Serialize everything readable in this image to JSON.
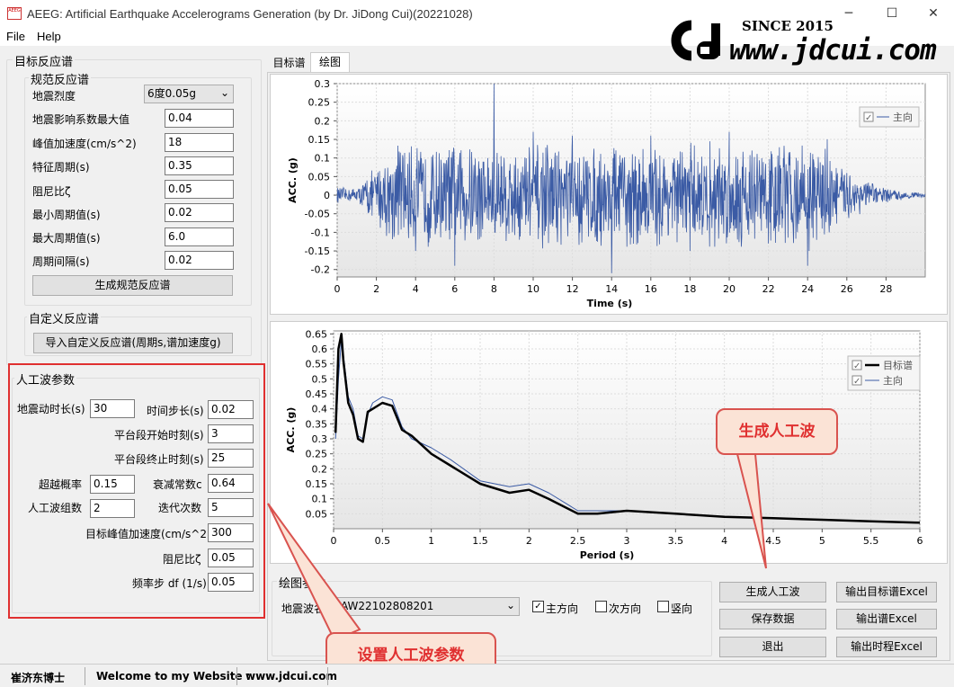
{
  "window": {
    "title": "AEEG: Artificial Earthquake Accelerograms Generation (by Dr. JiDong Cui)(20221028)",
    "icon_text": "AEEG"
  },
  "menu": {
    "file": "File",
    "help": "Help"
  },
  "logo": {
    "since": "SINCE 2015",
    "site": "www.jdcui.com"
  },
  "target": {
    "group": "目标反应谱",
    "code": {
      "group": "规范反应谱",
      "fields": [
        {
          "label": "地震烈度",
          "value": "6度0.05g"
        },
        {
          "label": "地震影响系数最大值",
          "value": "0.04"
        },
        {
          "label": "峰值加速度(cm/s^2)",
          "value": "18"
        },
        {
          "label": "特征周期(s)",
          "value": "0.35"
        },
        {
          "label": "阻尼比ζ",
          "value": "0.05"
        },
        {
          "label": "最小周期值(s)",
          "value": "0.02"
        },
        {
          "label": "最大周期值(s)",
          "value": "6.0"
        },
        {
          "label": "周期间隔(s)",
          "value": "0.02"
        }
      ],
      "button": "生成规范反应谱"
    },
    "custom": {
      "group": "自定义反应谱",
      "button": "导入自定义反应谱(周期s,谱加速度g)"
    }
  },
  "params": {
    "group": "人工波参数",
    "duration_label": "地震动时长(s)",
    "duration": "30",
    "step_label": "时间步长(s)",
    "step": "0.02",
    "plat_start_label": "平台段开始时刻(s)",
    "plat_start": "3",
    "plat_end_label": "平台段终止时刻(s)",
    "plat_end": "25",
    "exceed_label": "超越概率",
    "exceed": "0.15",
    "decay_label": "衰减常数c",
    "decay": "0.64",
    "groups_label": "人工波组数",
    "groups": "2",
    "iter_label": "迭代次数",
    "iter": "5",
    "pga_label": "目标峰值加速度(cm/s^2)",
    "pga": "300",
    "damp_label": "阻尼比ζ",
    "damp": "0.05",
    "df_label": "频率步 df (1/s)",
    "df": "0.05"
  },
  "tabs": [
    "目标谱",
    "绘图"
  ],
  "plot1": {
    "ylabel": "ACC. (g)",
    "xlabel": "Time (s)",
    "legend": "主向",
    "yticks": [
      "0.3",
      "0.25",
      "0.2",
      "0.15",
      "0.1",
      "0.05",
      "0",
      "-0.05",
      "-0.1",
      "-0.15",
      "-0.2"
    ],
    "xticks": [
      "0",
      "2",
      "4",
      "6",
      "8",
      "10",
      "12",
      "14",
      "16",
      "18",
      "20",
      "22",
      "24",
      "26",
      "28"
    ]
  },
  "plot2": {
    "ylabel": "ACC. (g)",
    "xlabel": "Period (s)",
    "legend1": "目标谱",
    "legend2": "主向",
    "yticks": [
      "0.65",
      "0.6",
      "0.55",
      "0.5",
      "0.45",
      "0.4",
      "0.35",
      "0.3",
      "0.25",
      "0.2",
      "0.15",
      "0.1",
      "0.05"
    ],
    "xticks": [
      "0",
      "0.5",
      "1",
      "1.5",
      "2",
      "2.5",
      "3",
      "3.5",
      "4",
      "4.5",
      "5",
      "5.5",
      "6"
    ]
  },
  "plot_params": {
    "group": "绘图参数",
    "wave_label": "地震波名",
    "wave": "AW22102808201",
    "main": "主方向",
    "second": "次方向",
    "vertical": "竖向",
    "main_checked": true
  },
  "buttons": {
    "gen": "生成人工波",
    "save": "保存数据",
    "exit": "退出",
    "out_target": "输出目标谱Excel",
    "out_spec": "输出谱Excel",
    "out_hist": "输出时程Excel"
  },
  "annotations": {
    "gen": "生成人工波",
    "params": "设置人工波参数"
  },
  "status": {
    "author": "崔济东博士",
    "welcome": "Welcome to my Website :",
    "site": "www.jdcui.com"
  },
  "colors": {
    "series": "#3b5ba5",
    "target": "#000000",
    "highlight": "#e03030"
  },
  "chart_data": [
    {
      "type": "line",
      "title": "",
      "xlabel": "Time (s)",
      "ylabel": "ACC. (g)",
      "xlim": [
        0,
        30
      ],
      "ylim": [
        -0.22,
        0.3
      ],
      "series": [
        {
          "name": "主向",
          "x": [
            0,
            1,
            1.5,
            2,
            3,
            4,
            6,
            8,
            8.05,
            10,
            12,
            14,
            16,
            18,
            20,
            22,
            24,
            25,
            26,
            27,
            28,
            30
          ],
          "values": [
            0,
            0.005,
            -0.01,
            0.03,
            0.07,
            -0.15,
            -0.19,
            0.3,
            -0.1,
            0.17,
            0.16,
            -0.21,
            0.16,
            -0.15,
            0.17,
            -0.13,
            -0.19,
            0.15,
            0.06,
            0.02,
            0.005,
            0
          ]
        }
      ]
    },
    {
      "type": "line",
      "title": "",
      "xlabel": "Period (s)",
      "ylabel": "ACC. (g)",
      "xlim": [
        0,
        6
      ],
      "ylim": [
        0,
        0.66
      ],
      "series": [
        {
          "name": "目标谱",
          "x": [
            0.02,
            0.05,
            0.08,
            0.1,
            0.15,
            0.2,
            0.25,
            0.3,
            0.35,
            0.4,
            0.5,
            0.6,
            0.7,
            0.8,
            1,
            1.2,
            1.5,
            1.8,
            2,
            2.2,
            2.5,
            2.7,
            3,
            3.5,
            4,
            4.5,
            5,
            5.5,
            6
          ],
          "values": [
            0.32,
            0.6,
            0.65,
            0.56,
            0.42,
            0.38,
            0.3,
            0.29,
            0.39,
            0.4,
            0.42,
            0.41,
            0.33,
            0.31,
            0.25,
            0.21,
            0.15,
            0.12,
            0.13,
            0.1,
            0.05,
            0.05,
            0.06,
            0.05,
            0.04,
            0.035,
            0.03,
            0.025,
            0.02
          ]
        },
        {
          "name": "主向",
          "x": [
            0.02,
            0.05,
            0.08,
            0.1,
            0.15,
            0.2,
            0.25,
            0.3,
            0.35,
            0.4,
            0.5,
            0.6,
            0.7,
            0.8,
            1,
            1.2,
            1.5,
            1.8,
            2,
            2.2,
            2.5,
            2.7,
            3,
            3.5,
            4,
            4.5,
            5,
            5.5,
            6
          ],
          "values": [
            0.3,
            0.5,
            0.63,
            0.58,
            0.44,
            0.4,
            0.31,
            0.3,
            0.38,
            0.42,
            0.44,
            0.43,
            0.34,
            0.3,
            0.27,
            0.23,
            0.16,
            0.14,
            0.15,
            0.12,
            0.06,
            0.06,
            0.06,
            0.05,
            0.04,
            0.035,
            0.03,
            0.025,
            0.02
          ]
        }
      ]
    }
  ]
}
